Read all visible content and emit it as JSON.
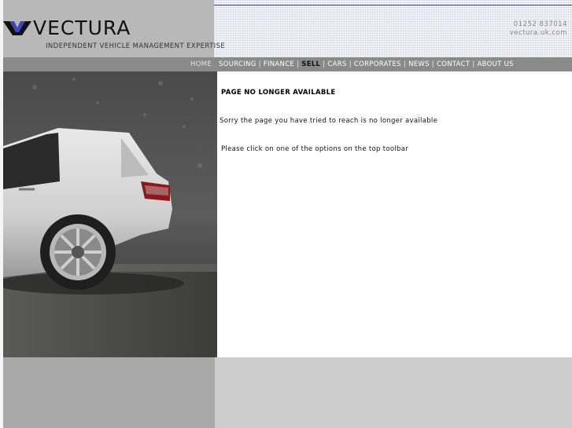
{
  "brand": {
    "name": "VECTURA",
    "tagline": "INDEPENDENT VEHICLE MANAGEMENT EXPERTISE"
  },
  "contact": {
    "phone": "01252 837014",
    "web": "vectura.uk.com"
  },
  "nav": {
    "items": [
      {
        "label": "HOME"
      },
      {
        "label": "SOURCING"
      },
      {
        "label": "FINANCE"
      },
      {
        "label": "SELL"
      },
      {
        "label": "CARS"
      },
      {
        "label": "CORPORATES"
      },
      {
        "label": "NEWS"
      },
      {
        "label": "CONTACT"
      },
      {
        "label": "ABOUT US"
      }
    ],
    "separator": "|"
  },
  "message": {
    "title": "PAGE NO LONGER AVAILABLE",
    "line1": "Sorry the page you have tried to reach is no longer available",
    "line2": "Please click on one of the options on the top toolbar"
  },
  "colors": {
    "header_gray": "#b8b8b8",
    "nav_gray": "#8a8a8a",
    "rule": "#3a3a6a",
    "footer_left": "#a9a9a9",
    "footer_right": "#cdcdcd"
  }
}
